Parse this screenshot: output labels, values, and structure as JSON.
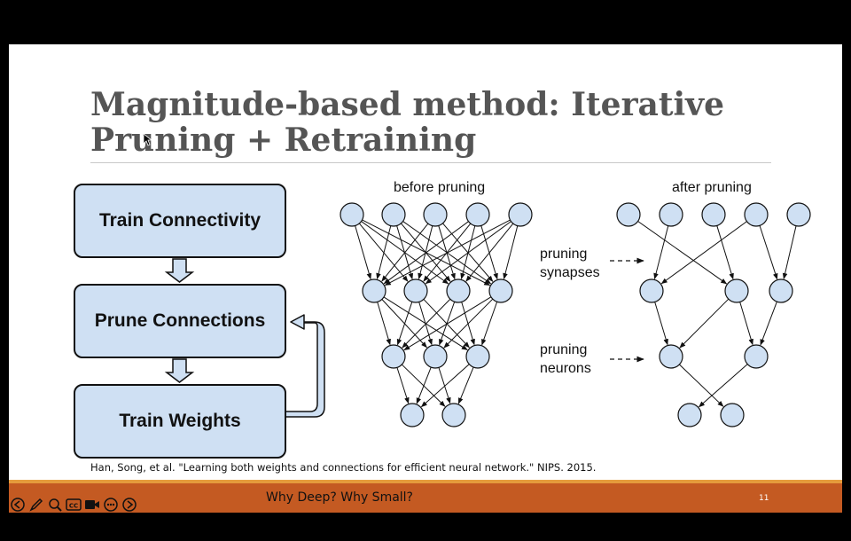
{
  "slide": {
    "title_line1": "Magnitude-based method: Iterative",
    "title_line2": "Pruning + Retraining",
    "flow": {
      "box1": "Train Connectivity",
      "box2": "Prune Connections",
      "box3": "Train Weights"
    },
    "network": {
      "before_label": "before pruning",
      "after_label": "after pruning",
      "pruning_synapses_line1": "pruning",
      "pruning_synapses_line2": "synapses",
      "pruning_neurons_line1": "pruning",
      "pruning_neurons_line2": "neurons"
    },
    "citation": "Han, Song, et al. \"Learning both weights and connections for efficient neural network.\" NIPS. 2015.",
    "colors": {
      "node_fill": "#cfe0f3",
      "box_fill": "#cfe0f3",
      "footer": "#c45a22",
      "footer_stripe": "#e59b3c"
    }
  },
  "footer": {
    "title": "Why Deep? Why Small?",
    "page_number": "11"
  },
  "toolbar": {
    "buttons": [
      "previous-slide-icon",
      "pen-icon",
      "zoom-icon",
      "captions-icon",
      "camera-icon",
      "more-icon",
      "next-slide-icon"
    ],
    "captions_label": "CC"
  }
}
